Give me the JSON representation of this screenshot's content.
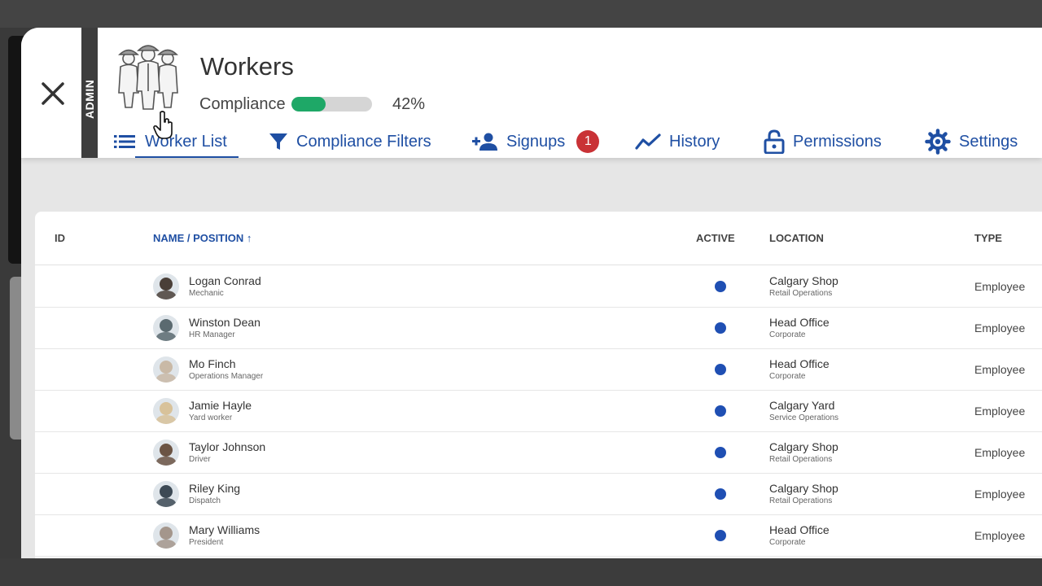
{
  "app": {
    "title": "Workers",
    "compliance_label": "Compliance",
    "compliance_percent": "42%",
    "compliance_value": 0.42,
    "admin_label": "ADMIN"
  },
  "tabs": [
    {
      "label": "Worker List",
      "icon": "list-icon",
      "active": true
    },
    {
      "label": "Compliance Filters",
      "icon": "filter-icon"
    },
    {
      "label": "Signups",
      "icon": "add-person-icon",
      "badge": "1"
    },
    {
      "label": "History",
      "icon": "trend-line-icon"
    },
    {
      "label": "Permissions",
      "icon": "lock-icon"
    },
    {
      "label": "Settings",
      "icon": "gear-icon"
    }
  ],
  "table": {
    "headers": {
      "id": "ID",
      "name": "NAME / POSITION",
      "sort_indicator": "↑",
      "active": "ACTIVE",
      "location": "LOCATION",
      "type": "TYPE"
    },
    "rows": [
      {
        "name": "Logan Conrad",
        "position": "Mechanic",
        "location": "Calgary Shop",
        "department": "Retail Operations",
        "type": "Employee",
        "active": true,
        "avatar_color": "#4a3f38"
      },
      {
        "name": "Winston Dean",
        "position": "HR Manager",
        "location": "Head Office",
        "department": "Corporate",
        "type": "Employee",
        "active": true,
        "avatar_color": "#5b6a70"
      },
      {
        "name": "Mo Finch",
        "position": "Operations Manager",
        "location": "Head Office",
        "department": "Corporate",
        "type": "Employee",
        "active": true,
        "avatar_color": "#c9b9a6"
      },
      {
        "name": "Jamie Hayle",
        "position": "Yard worker",
        "location": "Calgary Yard",
        "department": "Service Operations",
        "type": "Employee",
        "active": true,
        "avatar_color": "#d8c29a"
      },
      {
        "name": "Taylor Johnson",
        "position": "Driver",
        "location": "Calgary Shop",
        "department": "Retail Operations",
        "type": "Employee",
        "active": true,
        "avatar_color": "#6b5444"
      },
      {
        "name": "Riley King",
        "position": "Dispatch",
        "location": "Calgary Shop",
        "department": "Retail Operations",
        "type": "Employee",
        "active": true,
        "avatar_color": "#3d4a55"
      },
      {
        "name": "Mary Williams",
        "position": "President",
        "location": "Head Office",
        "department": "Corporate",
        "type": "Employee",
        "active": true,
        "avatar_color": "#a4968c"
      }
    ]
  },
  "colors": {
    "accent": "#1f4fa3",
    "progress": "#1ea867",
    "badge": "#c93236",
    "active_dot": "#1f4fb3"
  }
}
